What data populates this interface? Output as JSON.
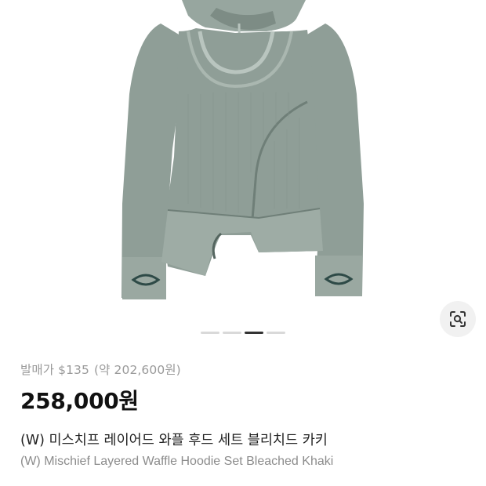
{
  "product": {
    "retail_label": "발매가",
    "retail_price_usd": "$135",
    "retail_price_krw": "(약 202,600원)",
    "price": "258,000원",
    "title_ko": "(W) 미스치프 레이어드 와플 후드 세트 블리치드 카키",
    "title_en": "(W) Mischief Layered Waffle Hoodie Set Bleached Khaki",
    "colors": {
      "garment": "#8f9e97",
      "garment_dark": "#6f7f78",
      "logo": "#2e4a47"
    }
  },
  "carousel": {
    "total": 4,
    "active_index": 2
  },
  "lens_button": {
    "icon": "image-search-icon"
  }
}
